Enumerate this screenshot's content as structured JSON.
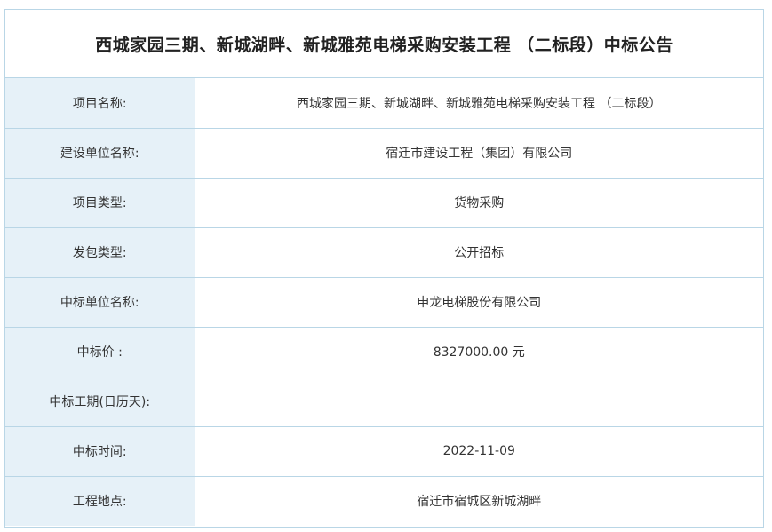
{
  "notice": {
    "title": "西城家园三期、新城湖畔、新城雅苑电梯采购安装工程 （二标段）中标公告",
    "rows": [
      {
        "label": "项目名称:",
        "value": "西城家园三期、新城湖畔、新城雅苑电梯采购安装工程 （二标段）"
      },
      {
        "label": "建设单位名称:",
        "value": "宿迁市建设工程（集团）有限公司"
      },
      {
        "label": "项目类型:",
        "value": "货物采购"
      },
      {
        "label": "发包类型:",
        "value": "公开招标"
      },
      {
        "label": "中标单位名称:",
        "value": "申龙电梯股份有限公司"
      },
      {
        "label": "中标价 :",
        "value": "8327000.00 元"
      },
      {
        "label": "中标工期(日历天):",
        "value": ""
      },
      {
        "label": "中标时间:",
        "value": "2022-11-09"
      },
      {
        "label": "工程地点:",
        "value": "宿迁市宿城区新城湖畔"
      }
    ]
  },
  "colors": {
    "label_bg": "#e6f1f8",
    "border": "#b9d6e6",
    "text": "#333333"
  }
}
